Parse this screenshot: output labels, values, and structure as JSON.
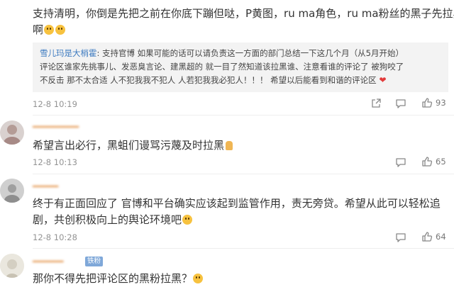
{
  "comments": [
    {
      "text_line1": "支持清明，你倒是先把之前在你底下蹦但哒，P黄图，ru ma角色，ru ma粉丝的黑子先拉黑",
      "text_line2": "啊",
      "quote": {
        "user": "雪儿玛是大梢霍",
        "line1_rest": ": 支持官博 如果可能的话可以请负责这一方面的部门总结一下这几个月（从5月开始）",
        "line2": "评论区谁家先挑事儿、发恶臭言论、建黑超的 就一目了然知道该拉黑谁、注意看谁的评论了 被狗咬了",
        "line3": "不反击 那不太合适 人不犯我我不犯人 人若犯我我必犯人！！！ 希望以后能看到和谐的评论区"
      },
      "time": "12-8 10:19",
      "likes": "93"
    },
    {
      "text": "希望言出必行，黑蛆们谩骂污蔑及时拉黑",
      "time": "12-8 10:13",
      "likes": "65"
    },
    {
      "text_line1": "终于有正面回应了 官博和平台确实应该起到监管作用，责无旁贷。希望从此可以轻松追",
      "text_line2": "剧，共创积极向上的舆论环境吧",
      "time": "12-8 10:28",
      "likes": "64"
    },
    {
      "badge": "铁粉",
      "text": "那你不得先把评论区的黑粉拉黑？"
    }
  ],
  "colors": {
    "link": "#3e7bc0",
    "meta": "#939393",
    "quote_bg": "#f3f3f3"
  },
  "icons": [
    "share-icon",
    "comment-icon",
    "like-icon"
  ]
}
